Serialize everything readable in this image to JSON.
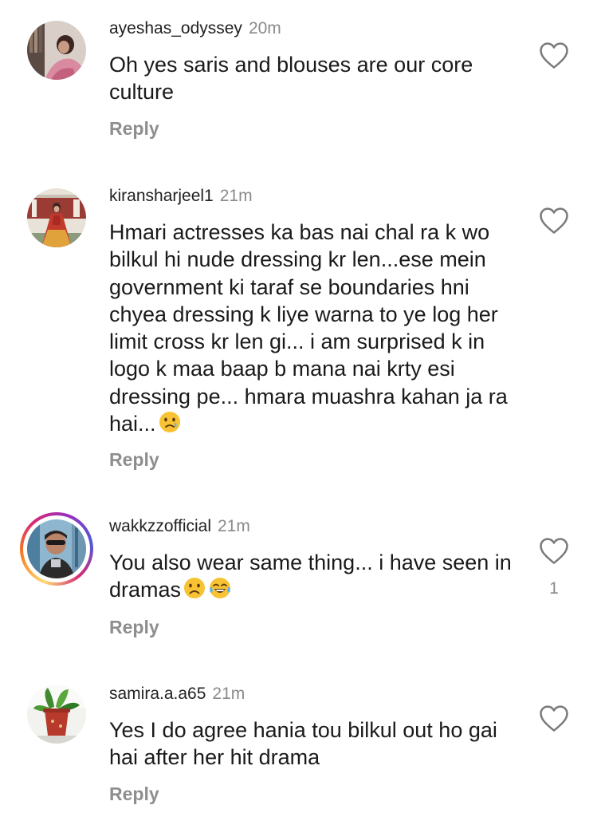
{
  "comments": [
    {
      "username": "ayeshas_odyssey",
      "time": "20m",
      "text": "Oh yes saris and blouses are our core culture",
      "reply_label": "Reply"
    },
    {
      "username": "kiransharjeel1",
      "time": "21m",
      "text": "Hmari actresses ka bas nai chal ra k wo bilkul hi nude dressing kr len...ese mein government ki taraf se boundaries hni chyea dressing k liye warna to ye log her limit cross kr len gi... i am surprised k in logo k maa baap b mana nai krty esi dressing pe... hmara muashra kahan ja ra hai...",
      "reply_label": "Reply"
    },
    {
      "username": "wakkzzofficial",
      "time": "21m",
      "text": "You also wear same thing... i have seen in dramas",
      "reply_label": "Reply",
      "like_count": "1"
    },
    {
      "username": "samira.a.a65",
      "time": "21m",
      "text": "Yes I do agree hania tou bilkul out ho gai hai after her hit drama",
      "reply_label": "Reply"
    }
  ],
  "icons": {
    "like": "heart-outline-icon",
    "emoji_crying": "crying-face-emoji",
    "emoji_frowning": "frowning-face-emoji",
    "emoji_laughing": "tears-of-joy-emoji"
  }
}
